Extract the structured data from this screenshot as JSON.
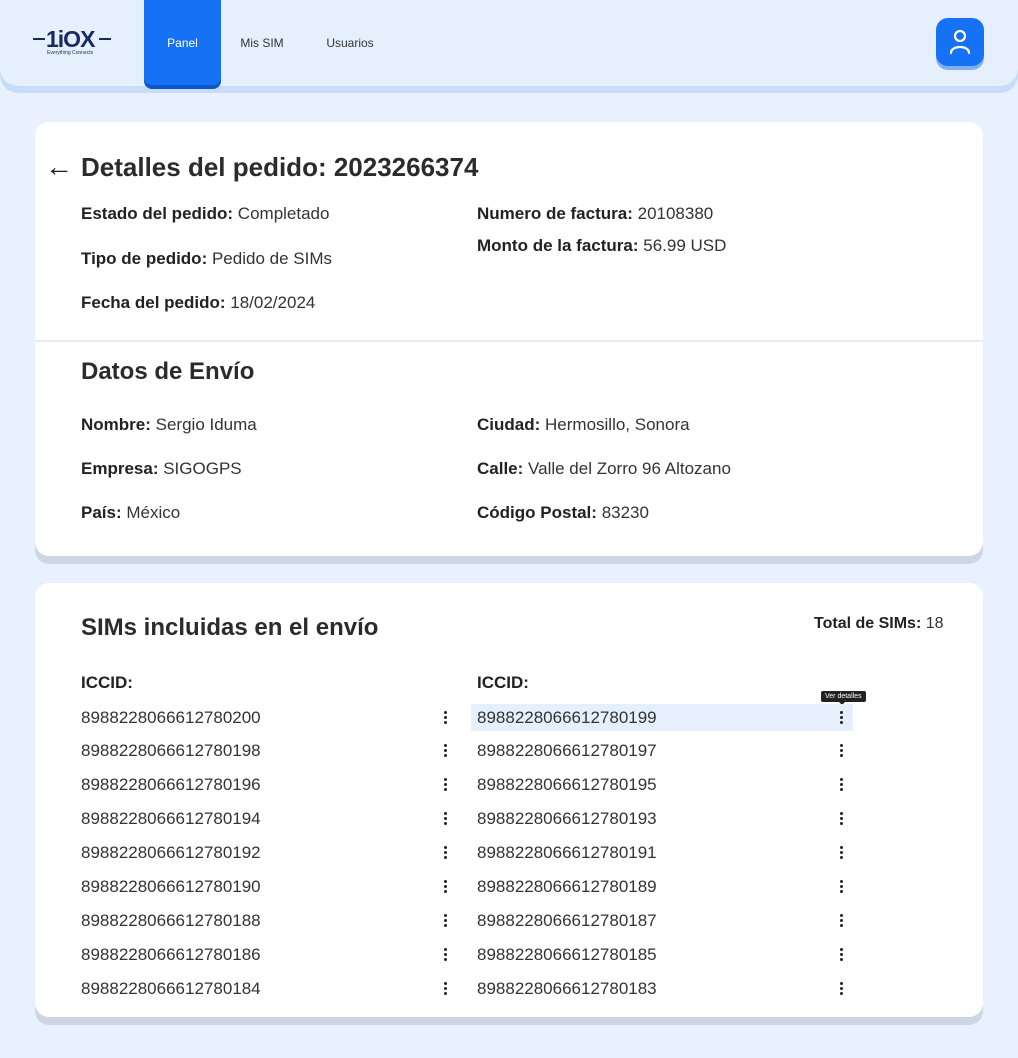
{
  "header": {
    "logo_text": "1iOX",
    "logo_tagline": "Everything Connects",
    "nav": [
      {
        "label": "Panel",
        "active": true
      },
      {
        "label": "Mis SIM",
        "active": false
      },
      {
        "label": "Usuarios",
        "active": false
      }
    ],
    "profile_icon": "user-icon"
  },
  "colors": {
    "accent": "#1671f5",
    "background": "#e8f1fd",
    "card": "#ffffff",
    "row_hover": "#e6f0fd"
  },
  "order": {
    "back_icon": "arrow-left-icon",
    "title": "Detalles del pedido: 2023266374",
    "status_label": "Estado del pedido:",
    "status_value": "Completado",
    "type_label": "Tipo de pedido:",
    "type_value": "Pedido de SIMs",
    "date_label": "Fecha del pedido:",
    "date_value": "18/02/2024",
    "invoice_label": "Numero de factura:",
    "invoice_value": "20108380",
    "amount_label": "Monto de la factura:",
    "amount_value": "56.99 USD"
  },
  "shipping": {
    "title": "Datos de Envío",
    "name_label": "Nombre:",
    "name_value": "Sergio Iduma",
    "company_label": "Empresa:",
    "company_value": "SIGOGPS",
    "country_label": "País:",
    "country_value": "México",
    "city_label": "Ciudad:",
    "city_value": "Hermosillo, Sonora",
    "street_label": "Calle:",
    "street_value": "Valle del Zorro 96 Altozano",
    "zip_label": "Código Postal:",
    "zip_value": "83230"
  },
  "sims": {
    "title": "SIMs incluidas en el envío",
    "total_label": "Total de SIMs:",
    "total_value": "18",
    "column_header": "ICCID:",
    "tooltip": "Ver detalles",
    "left": [
      "8988228066612780200",
      "8988228066612780198",
      "8988228066612780196",
      "8988228066612780194",
      "8988228066612780192",
      "8988228066612780190",
      "8988228066612780188",
      "8988228066612780186",
      "8988228066612780184"
    ],
    "right": [
      "8988228066612780199",
      "8988228066612780197",
      "8988228066612780195",
      "8988228066612780193",
      "8988228066612780191",
      "8988228066612780189",
      "8988228066612780187",
      "8988228066612780185",
      "8988228066612780183"
    ]
  }
}
